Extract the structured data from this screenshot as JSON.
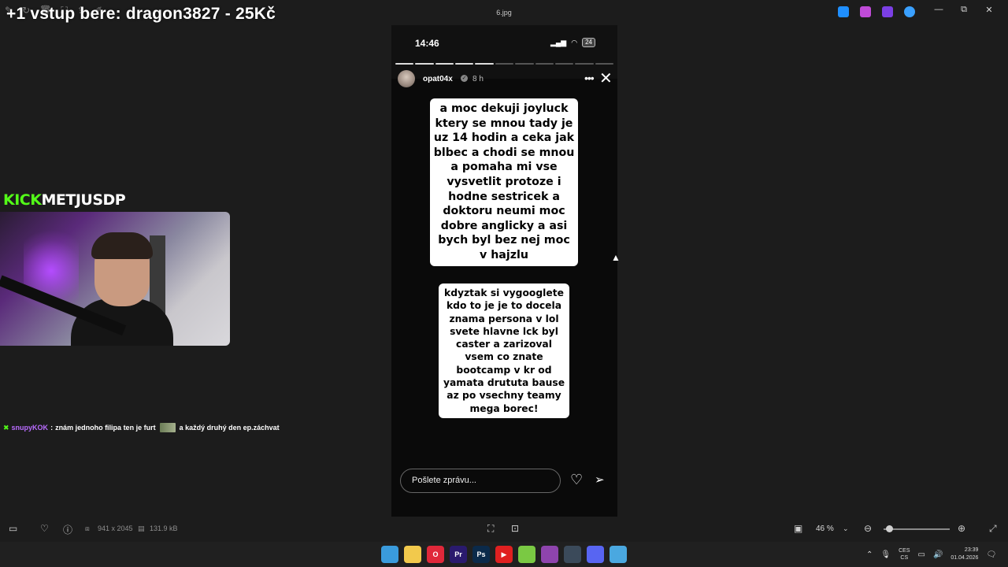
{
  "viewer": {
    "filename": "6.jpg",
    "toolbar_icons": [
      "edit-icon",
      "rotate-icon",
      "delete-icon",
      "crop-icon",
      "share-icon",
      "draw-icon"
    ],
    "window_controls": [
      "—",
      "⧉",
      "✕"
    ],
    "bottom": {
      "dimensions": "941 x 2045",
      "filesize": "131.9 kB",
      "zoom": "46 %"
    }
  },
  "stream": {
    "title": "+1 vstup bere: dragon3827 - 25Kč",
    "kick_logo": "KICK",
    "channel": "METJUSDP",
    "chat": {
      "user": "snupyKOK",
      "separator": ":",
      "message_a": "znám jednoho filipa ten je furt",
      "message_b": "a každý druhý den ep.záchvat"
    }
  },
  "story": {
    "status_time": "14:46",
    "battery": "24",
    "segments_total": 11,
    "segments_done": 5,
    "username": "opat04x",
    "posted": "8 h",
    "text_block_1": "a moc dekuji joyluck ktery se mnou tady je uz 14 hodin a ceka jak blbec a chodi se mnou a pomaha mi vse vysvetlit protoze i hodne sestricek a doktoru neumi moc dobre anglicky a asi bych byl bez nej moc v hajzlu",
    "text_block_2": "kdyztak si vygooglete kdo to je je to docela znama persona v lol svete hlavne lck byl caster a zarizoval vsem co znate bootcamp v kr od yamata drututa bause az po vsechny teamy mega borec!",
    "reply_placeholder": "Pošlete zprávu..."
  },
  "taskbar": {
    "apps": [
      {
        "name": "windows-start",
        "label": "",
        "color": "#3a9bdc"
      },
      {
        "name": "file-explorer",
        "label": "",
        "color": "#f2c94c"
      },
      {
        "name": "opera",
        "label": "O",
        "color": "#e0283a"
      },
      {
        "name": "premiere",
        "label": "Pr",
        "color": "#2a1a6e"
      },
      {
        "name": "photoshop",
        "label": "Ps",
        "color": "#0b2a4a"
      },
      {
        "name": "youtube",
        "label": "▶",
        "color": "#e02020"
      },
      {
        "name": "android",
        "label": "",
        "color": "#7ac943"
      },
      {
        "name": "twitch",
        "label": "",
        "color": "#8e44ad"
      },
      {
        "name": "steam",
        "label": "",
        "color": "#3b4a5a"
      },
      {
        "name": "discord",
        "label": "",
        "color": "#5865f2"
      },
      {
        "name": "photos",
        "label": "",
        "color": "#4aa8e0"
      }
    ],
    "lang_top": "CES",
    "lang_bottom": "CS",
    "time": "23:39",
    "date": "01.04.2026"
  },
  "colors": {
    "kick_green": "#53fc18",
    "chat_user": "#b96cff"
  }
}
